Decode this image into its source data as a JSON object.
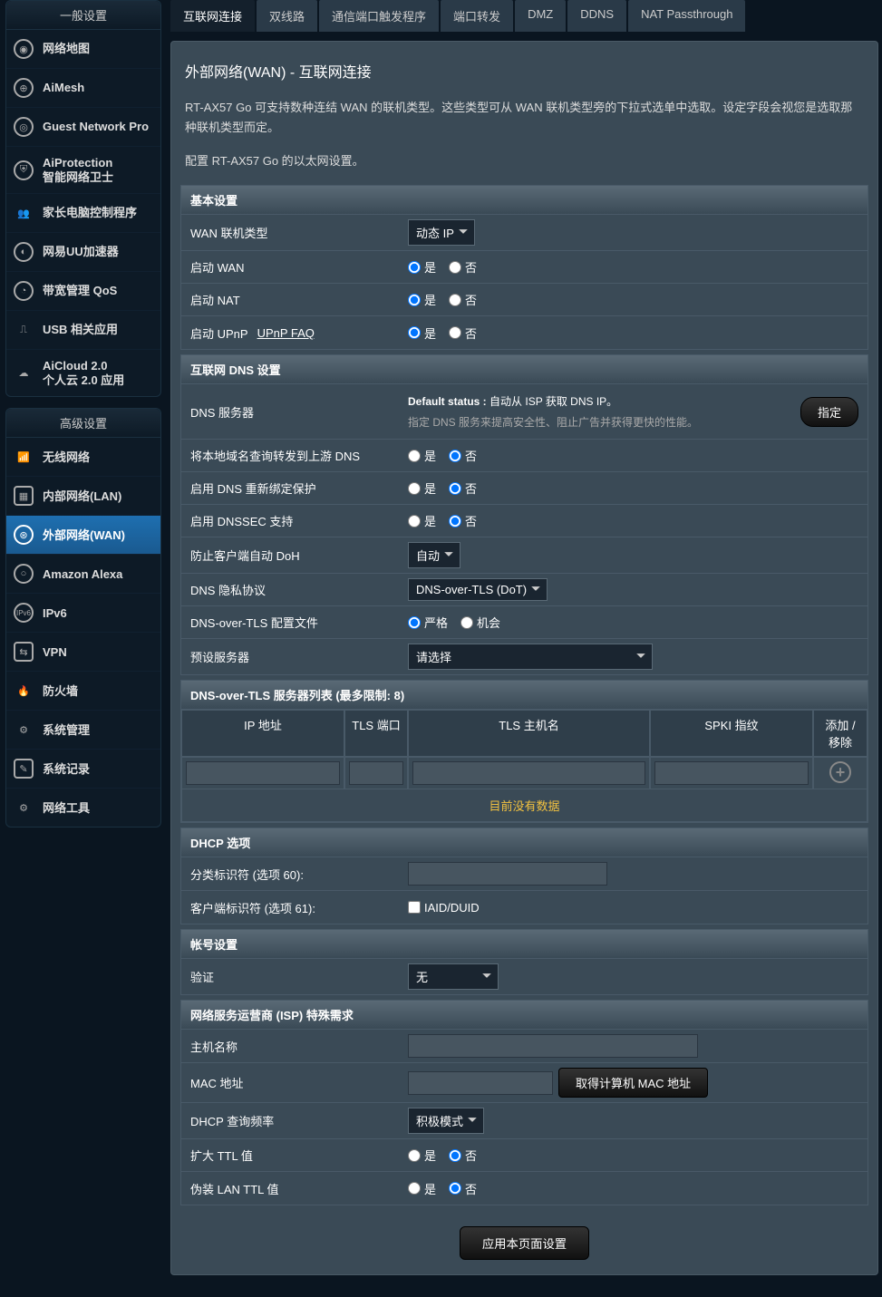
{
  "sidebar": {
    "group1_title": "一般设置",
    "group2_title": "高级设置",
    "general": [
      {
        "label": "网络地图"
      },
      {
        "label": "AiMesh"
      },
      {
        "label": "Guest Network Pro"
      },
      {
        "label": "AiProtection\n智能网络卫士"
      },
      {
        "label": "家长电脑控制程序"
      },
      {
        "label": "网易UU加速器"
      },
      {
        "label": "带宽管理 QoS"
      },
      {
        "label": "USB 相关应用"
      },
      {
        "label": "AiCloud 2.0\n个人云 2.0 应用"
      }
    ],
    "advanced": [
      {
        "label": "无线网络"
      },
      {
        "label": "内部网络(LAN)"
      },
      {
        "label": "外部网络(WAN)"
      },
      {
        "label": "Amazon Alexa"
      },
      {
        "label": "IPv6"
      },
      {
        "label": "VPN"
      },
      {
        "label": "防火墙"
      },
      {
        "label": "系统管理"
      },
      {
        "label": "系统记录"
      },
      {
        "label": "网络工具"
      }
    ]
  },
  "tabs": [
    "互联网连接",
    "双线路",
    "通信端口触发程序",
    "端口转发",
    "DMZ",
    "DDNS",
    "NAT Passthrough"
  ],
  "page": {
    "title": "外部网络(WAN) - 互联网连接",
    "desc1": "RT-AX57 Go 可支持数种连结 WAN 的联机类型。这些类型可从 WAN 联机类型旁的下拉式选单中选取。设定字段会视您是选取那种联机类型而定。",
    "desc2": "配置 RT-AX57 Go 的以太网设置。"
  },
  "labels": {
    "yes": "是",
    "no": "否"
  },
  "basic": {
    "head": "基本设置",
    "wan_type_label": "WAN 联机类型",
    "wan_type_value": "动态 IP",
    "enable_wan_label": "启动 WAN",
    "enable_nat_label": "启动 NAT",
    "enable_upnp_label": "启动 UPnP",
    "upnp_faq": "UPnP FAQ"
  },
  "dns": {
    "head": "互联网 DNS 设置",
    "server_label": "DNS 服务器",
    "default_prefix": "Default status :",
    "default_text": " 自动从 ISP 获取 DNS IP。",
    "hint": "指定 DNS 服务来提高安全性、阻止广告并获得更快的性能。",
    "assign_btn": "指定",
    "forward_label": "将本地域名查询转发到上游 DNS",
    "rebind_label": "启用 DNS 重新绑定保护",
    "dnssec_label": "启用 DNSSEC 支持",
    "doh_label": "防止客户端自动 DoH",
    "doh_value": "自动",
    "privacy_label": "DNS 隐私协议",
    "privacy_value": "DNS-over-TLS (DoT)",
    "dot_profile_label": "DNS-over-TLS 配置文件",
    "dot_strict": "严格",
    "dot_opp": "机会",
    "preset_label": "预设服务器",
    "preset_value": "请选择"
  },
  "tls": {
    "head": "DNS-over-TLS 服务器列表 (最多限制: 8)",
    "col_ip": "IP 地址",
    "col_port": "TLS 端口",
    "col_host": "TLS 主机名",
    "col_spki": "SPKI 指纹",
    "col_act": "添加 / 移除",
    "no_data": "目前没有数据"
  },
  "dhcp": {
    "head": "DHCP 选项",
    "class_label": "分类标识符 (选项 60):",
    "client_label": "客户端标识符 (选项 61):",
    "iaid": "IAID/DUID"
  },
  "account": {
    "head": "帐号设置",
    "auth_label": "验证",
    "auth_value": "无"
  },
  "isp": {
    "head": "网络服务运营商 (ISP) 特殊需求",
    "host_label": "主机名称",
    "mac_label": "MAC 地址",
    "mac_btn": "取得计算机 MAC 地址",
    "dhcp_freq_label": "DHCP 查询频率",
    "dhcp_freq_value": "积极模式",
    "ttl_label": "扩大 TTL 值",
    "lan_ttl_label": "伪装 LAN TTL 值"
  },
  "apply": "应用本页面设置"
}
